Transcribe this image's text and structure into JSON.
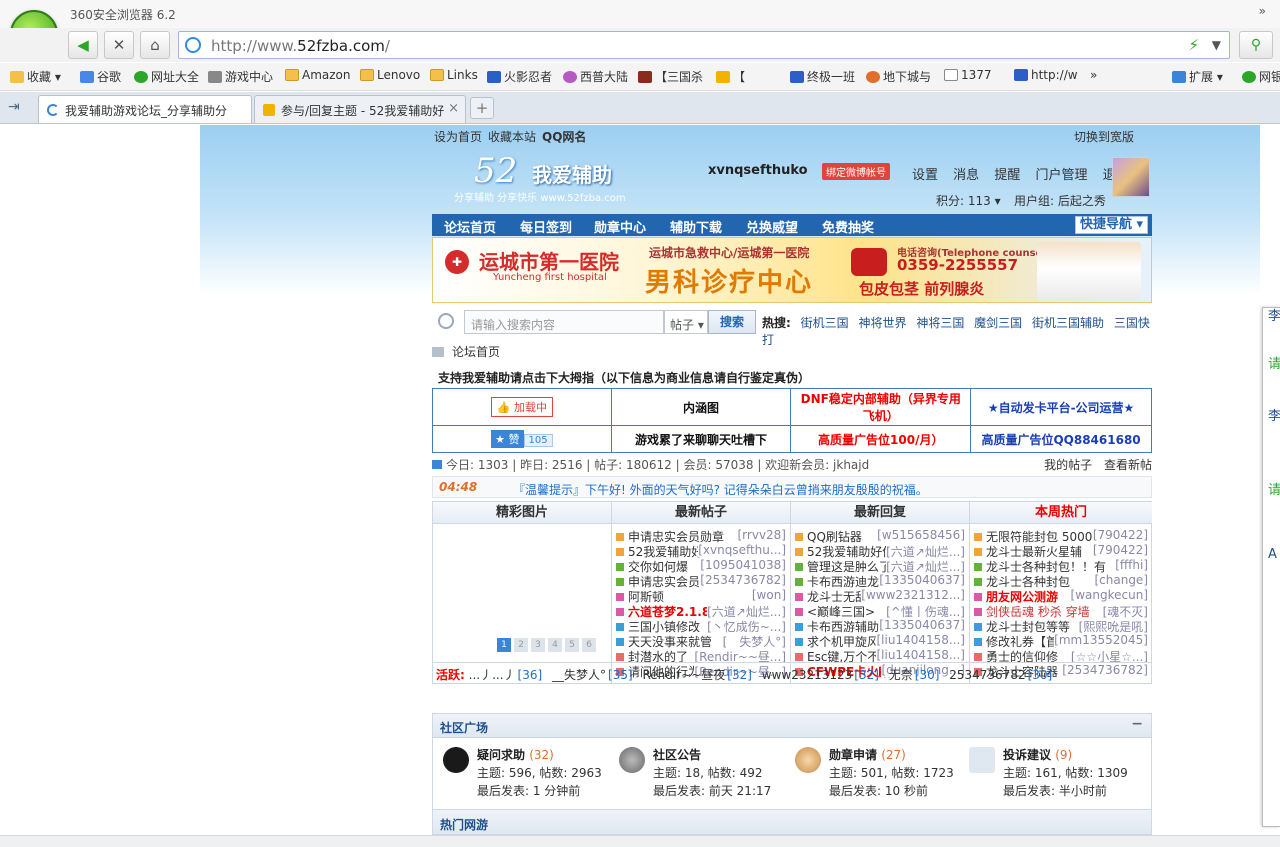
{
  "browser": {
    "app_title": "360安全浏览器 6.2",
    "url_prefix": "http://www.",
    "url_domain": "52fzba.com",
    "url_suffix": "/",
    "window_ctrl": "»"
  },
  "bookmarks": [
    {
      "label": "收藏 ▾",
      "icon": "star-icon"
    },
    {
      "label": "谷歌",
      "icon": "google-icon"
    },
    {
      "label": "网址大全",
      "icon": "globe-icon"
    },
    {
      "label": "游戏中心",
      "icon": "gamepad-icon"
    },
    {
      "label": "Amazon",
      "icon": "folder-icon"
    },
    {
      "label": "Lenovo",
      "icon": "folder-icon"
    },
    {
      "label": "Links",
      "icon": "folder-icon"
    },
    {
      "label": "火影忍者",
      "icon": "paw-icon"
    },
    {
      "label": "西普大陆",
      "icon": "site-icon"
    },
    {
      "label": "【三国杀",
      "icon": "site-icon"
    },
    {
      "label": "【",
      "icon": "cup-icon"
    },
    {
      "label": "终极一班",
      "icon": "paw-icon"
    },
    {
      "label": "地下城与",
      "icon": "site-icon"
    },
    {
      "label": "1377",
      "icon": "page-icon"
    },
    {
      "label": "http://w",
      "icon": "site-icon"
    },
    {
      "label": "»",
      "icon": ""
    },
    {
      "label": "扩展 ▾",
      "icon": "extension-icon"
    },
    {
      "label": "网银",
      "icon": "bank-icon"
    }
  ],
  "tabs": [
    {
      "label": "我爱辅助游戏论坛_分享辅助分",
      "close": "×"
    },
    {
      "label": "参与/回复主题 - 52我爱辅助好",
      "close": "×"
    }
  ],
  "new_tab": "+",
  "site": {
    "top_links": {
      "set_home": "设为首页",
      "bookmark": "收藏本站",
      "qq": "QQ网名",
      "wide": "切换到宽版"
    },
    "logo": {
      "num": "52",
      "title": "我爱辅助",
      "slogan": "分享辅助  分享快乐  www.52fzba.com"
    },
    "user": {
      "name": "xvnqsefthuko",
      "weibo": "绑定微博帐号",
      "links": [
        "设置",
        "消息",
        "提醒",
        "门户管理",
        "退出"
      ],
      "points": "积分: 113 ▾",
      "group": "用户组: 后起之秀"
    },
    "main_nav": [
      "论坛首页",
      "每日签到",
      "勋章中心",
      "辅助下载",
      "兑换威望",
      "免费抽奖"
    ],
    "quick_nav": "快捷导航 ▾",
    "banner": {
      "hospital_name": "运城市第一医院",
      "hospital_en": "Yuncheng first hospital",
      "center_top": "运城市急救中心/运城第一医院",
      "center_main": "男科诊疗中心",
      "phone_label": "电话咨询(Telephone counseling)",
      "phone": "0359-2255557",
      "services": "包皮包茎  前列腺炎"
    },
    "search": {
      "placeholder": "请输入搜索内容",
      "type": "帖子 ▾",
      "button": "搜索",
      "hot_label": "热搜:",
      "hot": [
        "街机三国",
        "神将世界",
        "神将三国",
        "魔剑三国",
        "街机三国辅助",
        "三国快打"
      ]
    },
    "breadcrumb": "论坛首页",
    "ad_caption": "支持我爱辅助请点击下大拇指（以下信息为商业信息请自行鉴定真伪）",
    "ads_row1": {
      "load": "加载中",
      "c2": "内涵图",
      "c3": "DNF稳定内部辅助（异界专用飞机）",
      "c4": "★自动发卡平台-公司运营★"
    },
    "ads_row2": {
      "like": "赞",
      "like_count": "105",
      "c2": "游戏累了来聊聊天吐槽下",
      "c3": "高质量广告位100/月）",
      "c4": "高质量广告位QQ88461680"
    },
    "stats": {
      "left": "今日: 1303 | 昨日: 2516 | 帖子: 180612 | 会员: 57038 | 欢迎新会员: jkhajd",
      "my_posts": "我的帖子",
      "view_new": "查看新帖"
    },
    "tip": {
      "clock": "04:48",
      "text": "『温馨提示』下午好! 外面的天气好吗? 记得朵朵白云曾捎来朋友殷殷的祝福。"
    },
    "columns": {
      "pictures": "精彩图片",
      "new_posts": "最新帖子",
      "new_replies": "最新回复",
      "weekly_hot": "本周热门"
    },
    "new_posts": [
      {
        "t": "申请忠实会员勋章",
        "a": "[rrvv28]"
      },
      {
        "t": "52我爱辅助好",
        "a": "[xvnqsefthu...]"
      },
      {
        "t": "交你如何爆",
        "a": "[1095041038]"
      },
      {
        "t": "申请忠实会员",
        "a": "[2534736782]"
      },
      {
        "t": "阿斯顿",
        "a": "[won]"
      },
      {
        "t": "六道苍梦2.1.8",
        "a": "[六道↗灿烂...]"
      },
      {
        "t": "三国小镇修改",
        "a": "[丶忆成伤~...]"
      },
      {
        "t": "天天没事来就管",
        "a": "[__失梦人°]"
      },
      {
        "t": "封潜水的了",
        "a": "[Rendir~~昼...]"
      },
      {
        "t": "请问他的行为",
        "a": "[Rendir~~昼...]"
      }
    ],
    "new_replies": [
      {
        "t": "QQ刷钻器",
        "a": "[w515658456]"
      },
      {
        "t": "52我爱辅助好像",
        "a": "[六道↗灿烂...]"
      },
      {
        "t": "管理这是肿么了",
        "a": "[六道↗灿烂...]"
      },
      {
        "t": "卡布西游迪龙",
        "a": "[1335040637]"
      },
      {
        "t": "龙斗士无敌",
        "a": "[www2321312...]"
      },
      {
        "t": "<巅峰三国>",
        "a": "[^懂丨伤魂...]"
      },
      {
        "t": "卡布西游辅助",
        "a": "[1335040637]"
      },
      {
        "t": "求个机甲旋风",
        "a": "[liu1404158...]"
      },
      {
        "t": "Esc键,万个不",
        "a": "[liu1404158...]"
      },
      {
        "t": "CFWPE卡火麒",
        "a": "[duanjilong...]"
      }
    ],
    "weekly_hot": [
      {
        "t": "无限符能封包 5000",
        "a": "[790422]"
      },
      {
        "t": "龙斗士最新火星辅",
        "a": "[790422]"
      },
      {
        "t": "龙斗士各种封包！！有",
        "a": "[fffhi]"
      },
      {
        "t": "龙斗士各种封包",
        "a": "[change]"
      },
      {
        "t": "朋友网公测游",
        "a": "[wangkecun]"
      },
      {
        "t": "剑侠岳魂 秒杀 穿墙",
        "a": "[魂不灭]"
      },
      {
        "t": "龙斗士封包等等",
        "a": "[熙熙吮是吼]"
      },
      {
        "t": "修改礼券【首",
        "a": "[mm13552045]"
      },
      {
        "t": "勇士的信仰修",
        "a": "[☆☆小星☆...]"
      },
      {
        "t": "龙斗士容陆器",
        "a": "[2534736782]"
      }
    ],
    "pager": [
      "1",
      "2",
      "3",
      "4",
      "5",
      "6"
    ],
    "active": {
      "label": "活跃:",
      "users": [
        {
          "n": "...丿...丿",
          "c": "[36]"
        },
        {
          "n": "__失梦人°",
          "c": "[35]"
        },
        {
          "n": "Rendir~~昼夜",
          "c": "[32]"
        },
        {
          "n": "www23213123",
          "c": "[32]"
        },
        {
          "n": "无奈",
          "c": "[30]"
        },
        {
          "n": "2534736782",
          "c": "[30]"
        }
      ]
    },
    "square": {
      "title": "社区广场",
      "collapse": "−",
      "forums": [
        {
          "name": "疑问求助",
          "count": "(32)",
          "l1": "主题: 596, 帖数: 2963",
          "l2": "最后发表: 1 分钟前",
          "icon": "ghost-icon"
        },
        {
          "name": "社区公告",
          "count": "",
          "l1": "主题: 18, 帖数: 492",
          "l2": "最后发表: 前天 21:17",
          "icon": "megaphone-icon"
        },
        {
          "name": "勋章申请",
          "count": "(27)",
          "l1": "主题: 501, 帖数: 1723",
          "l2": "最后发表: 10 秒前",
          "icon": "medal-icon"
        },
        {
          "name": "投诉建议",
          "count": "(9)",
          "l1": "主题: 161, 帖数: 1309",
          "l2": "最后发表: 半小时前",
          "icon": "feedback-icon"
        }
      ]
    },
    "hot_games": "热门网游"
  },
  "side_links": [
    "李",
    "请",
    "李",
    "请",
    "A"
  ]
}
